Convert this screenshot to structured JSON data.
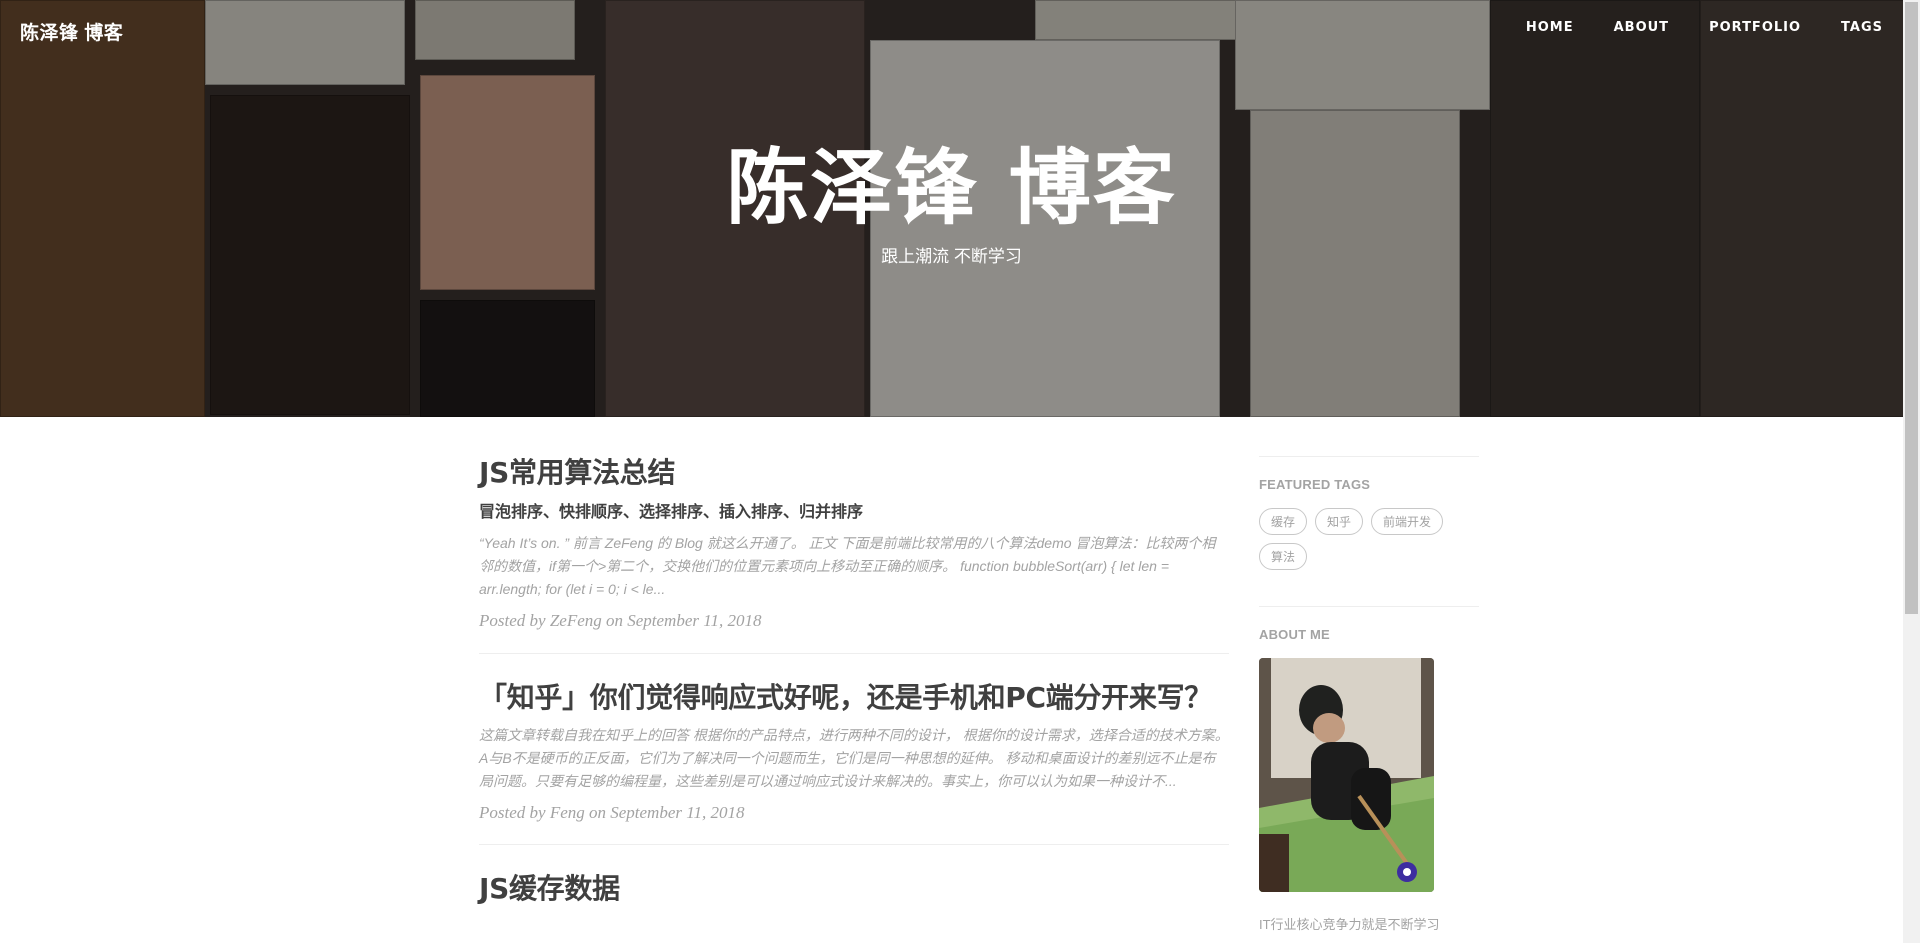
{
  "navbar": {
    "brand": "陈泽锋 博客",
    "links": [
      "HOME",
      "ABOUT",
      "PORTFOLIO",
      "TAGS"
    ]
  },
  "header": {
    "title": "陈泽锋 博客",
    "subtitle": "跟上潮流 不断学习"
  },
  "posts": [
    {
      "title": "JS常用算法总结",
      "subtitle": "冒泡排序、快排顺序、选择排序、插入排序、归并排序",
      "excerpt": "“Yeah It’s on. ” 前言 ZeFeng 的 Blog 就这么开通了。 正文 下面是前端比较常用的八个算法demo 冒泡算法：比较两个相邻的数值，if第一个>第二个，交换他们的位置元素项向上移动至正确的顺序。 function bubbleSort(arr) { let len = arr.length; for (let i = 0; i < le...",
      "meta": "Posted by ZeFeng on September 11, 2018"
    },
    {
      "title": "「知乎」你们觉得响应式好呢，还是手机和PC端分开来写？",
      "subtitle": "",
      "excerpt": "这篇文章转载自我在知乎上的回答 根据你的产品特点，进行两种不同的设计， 根据你的设计需求，选择合适的技术方案。 A与B不是硬币的正反面，它们为了解决同一个问题而生，它们是同一种思想的延伸。 移动和桌面设计的差别远不止是布局问题。只要有足够的编程量，这些差别是可以通过响应式设计来解决的。事实上，你可以认为如果一种设计不...",
      "meta": "Posted by Feng on September 11, 2018"
    },
    {
      "title": "JS缓存数据",
      "subtitle": "",
      "excerpt": "",
      "meta": ""
    }
  ],
  "sidebar": {
    "featured_tags_heading": "FEATURED TAGS",
    "tags": [
      "缓存",
      "知乎",
      "前端开发",
      "算法"
    ],
    "about_heading": "ABOUT ME",
    "about_text": "IT行业核心竞争力就是不断学习"
  },
  "colors": {
    "heading_text": "#404040",
    "muted_text": "#a3a3a3",
    "divider": "#eeeeee",
    "hero_overlay": "rgba(0,0,0,0.38)"
  }
}
